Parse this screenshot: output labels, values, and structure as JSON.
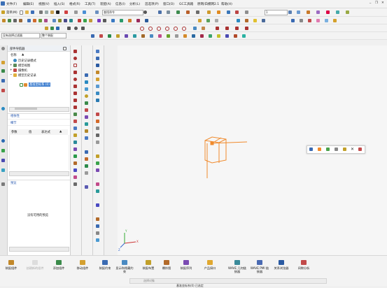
{
  "menubar": {
    "items": [
      "文件(F)",
      "编辑(E)",
      "视图(V)",
      "插入(S)",
      "格式(R)",
      "工具(T)",
      "装配(A)",
      "信息(I)",
      "分析(L)",
      "首选项(P)",
      "窗口(O)",
      "GC工具箱",
      "原网/白模网2.1",
      "帮助(H)"
    ],
    "window_controls": [
      "_",
      "❐",
      "✕"
    ]
  },
  "toolbar": {
    "command_finder_value": "查找命令",
    "menu_label": "菜单(M)",
    "zoom_value": "1",
    "selection_filter_value": "没有选择过滤器",
    "assembly_scope_value": "整个装配"
  },
  "navigator": {
    "title": "部件导航器",
    "column_name": "名称",
    "tree": [
      {
        "label": "历史记录模式",
        "indent": 1
      },
      {
        "label": "模型视图",
        "indent": 1
      },
      {
        "label": "摄像机",
        "indent": 1
      },
      {
        "label": "模型历史记录",
        "indent": 1
      },
      {
        "label": "基准坐标系 (0)",
        "indent": 2,
        "selected": true
      }
    ],
    "dependencies_label": "相依性",
    "details_label": "细节",
    "details_columns": [
      "参数",
      "值",
      "表达式"
    ],
    "preview_label": "预览",
    "no_preview_text": "没有可用的预览"
  },
  "viewport": {
    "background_color": "#f6f6f6",
    "csys_color": "#f08a2c",
    "triad_labels": [
      "X",
      "Y",
      "Z"
    ],
    "mini_toolbar_icons": [
      "edit-icon",
      "csys-icon",
      "display-icon",
      "hide-icon",
      "delete-icon",
      "more-icon"
    ]
  },
  "bottom_commands": [
    {
      "label": "装配组件",
      "icon": "assembly-icon"
    },
    {
      "label": "创建新的组件",
      "icon": "new-component-icon",
      "disabled": true
    },
    {
      "label": "添加组件",
      "icon": "add-component-icon"
    },
    {
      "label": "移动组件",
      "icon": "move-component-icon"
    },
    {
      "label": "装配约束",
      "icon": "constraint-icon"
    },
    {
      "label": "显示和隐藏约束",
      "icon": "show-hide-constraint-icon"
    },
    {
      "label": "装配布置",
      "icon": "arrangement-icon"
    },
    {
      "label": "爆炸图",
      "icon": "exploded-view-icon"
    },
    {
      "label": "装配序列",
      "icon": "sequence-icon"
    },
    {
      "label": "产品接口",
      "icon": "product-interface-icon"
    },
    {
      "label": "WAVE 几何链接器",
      "icon": "wave-geometry-icon"
    },
    {
      "label": "WAVE PMI 链接器",
      "icon": "wave-pmi-icon"
    },
    {
      "label": "关系浏览器",
      "icon": "relationship-browser-icon"
    },
    {
      "label": "间隙分析",
      "icon": "clearance-analysis-icon"
    }
  ],
  "status": {
    "text": "基准坐标系(0) 已选定",
    "prompt_placeholder": "选择对象"
  }
}
